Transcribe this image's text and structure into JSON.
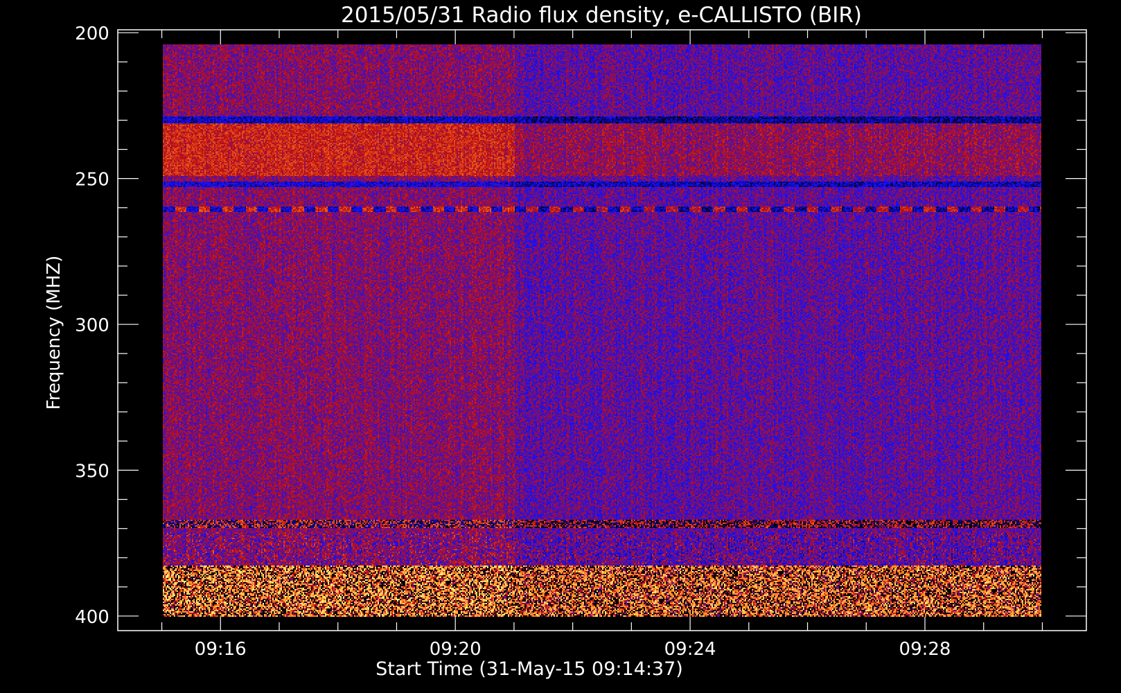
{
  "chart_data": {
    "type": "heatmap",
    "title": "2015/05/31  Radio flux density, e-CALLISTO (BIR)",
    "xlabel": "Start Time (31-May-15 09:14:37)",
    "ylabel": "Frequency (MHZ)",
    "y_tick_labels": [
      "200",
      "250",
      "300",
      "350",
      "400"
    ],
    "y_ticks": [
      200,
      250,
      300,
      350,
      400
    ],
    "ylim": [
      405,
      199
    ],
    "y_inverted": true,
    "x_tick_labels": [
      "09:16",
      "09:20",
      "09:24",
      "09:28"
    ],
    "x_ticks_minutes": [
      16,
      20,
      24,
      28
    ],
    "x_data_range_minutes": [
      15.0,
      30.0
    ],
    "x_axis_range_minutes": [
      14.25,
      30.75
    ],
    "colormap": [
      "#000000",
      "#1010ff",
      "#c01010",
      "#ff8020",
      "#ffff80"
    ],
    "grid": false,
    "features": [
      {
        "name": "background change",
        "time_minutes": 21.0
      },
      {
        "name": "bright band",
        "freq_range": [
          228,
          247
        ],
        "time_range": [
          15.0,
          21.0
        ]
      },
      {
        "name": "interference line",
        "freq": 259
      },
      {
        "name": "interference band",
        "freq": 372
      },
      {
        "name": "intense emission",
        "freq_range": [
          387,
          405
        ]
      }
    ]
  },
  "colors": {
    "background": "#000000",
    "axes": "#ffffff",
    "text": "#ffffff"
  }
}
